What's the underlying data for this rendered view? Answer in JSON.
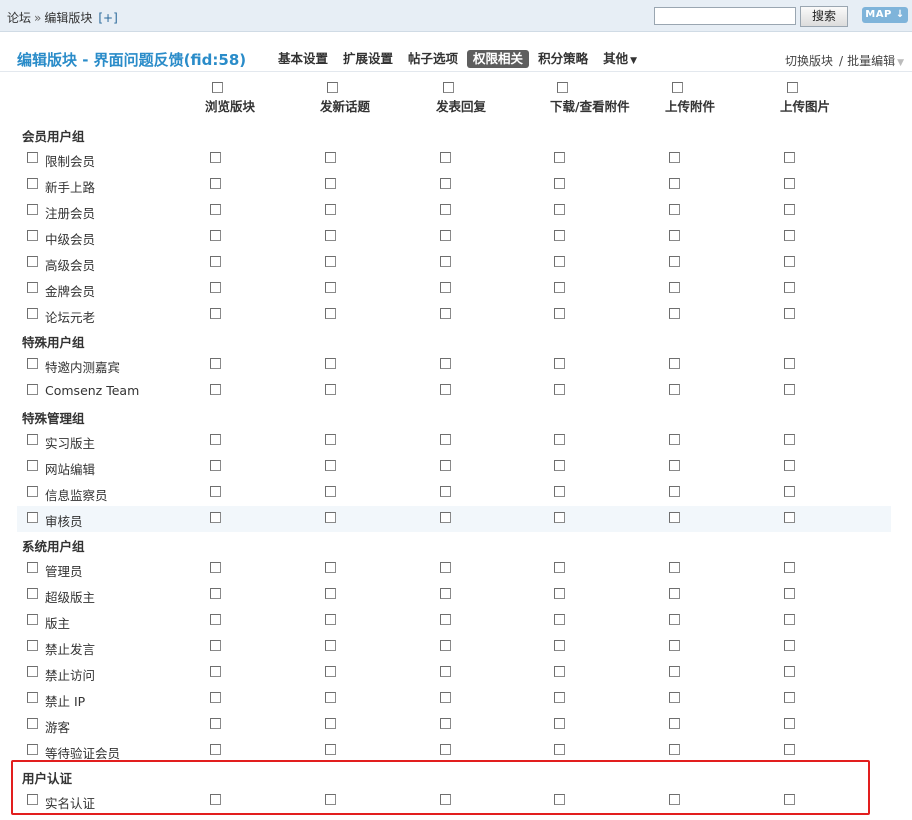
{
  "topbar": {
    "breadcrumb": [
      "论坛",
      "编辑版块"
    ],
    "breadcrumb_sep": "»",
    "add_label": "[+]",
    "search_value": "",
    "search_button": "搜索",
    "map_label": "MAP"
  },
  "nav": {
    "title": "编辑版块 - 界面问题反馈(fid:58)",
    "tabs": [
      {
        "label": "基本设置",
        "active": false
      },
      {
        "label": "扩展设置",
        "active": false
      },
      {
        "label": "帖子选项",
        "active": false
      },
      {
        "label": "权限相关",
        "active": true
      },
      {
        "label": "积分策略",
        "active": false
      },
      {
        "label": "其他",
        "active": false
      }
    ],
    "switch_label": "切换版块",
    "batch_label": "批量编辑"
  },
  "columns": [
    "浏览版块",
    "发新话题",
    "发表回复",
    "下载/查看附件",
    "上传附件",
    "上传图片"
  ],
  "groups": [
    {
      "title": "会员用户组",
      "rows": [
        "限制会员",
        "新手上路",
        "注册会员",
        "中级会员",
        "高级会员",
        "金牌会员",
        "论坛元老"
      ]
    },
    {
      "title": "特殊用户组",
      "rows": [
        "特邀内测嘉宾",
        "Comsenz Team"
      ]
    },
    {
      "title": "特殊管理组",
      "rows": [
        "实习版主",
        "网站编辑",
        "信息监察员",
        "审核员"
      ]
    },
    {
      "title": "系统用户组",
      "rows": [
        "管理员",
        "超级版主",
        "版主",
        "禁止发言",
        "禁止访问",
        "禁止 IP",
        "游客",
        "等待验证会员"
      ]
    },
    {
      "title": "用户认证",
      "rows": [
        "实名认证"
      ]
    }
  ],
  "highlighted_row": "审核员",
  "colors": {
    "title": "#2a8cc9",
    "active_tab": "#5e5e5e",
    "callout": "#e21e1e",
    "topbar": "#e7eef5"
  }
}
